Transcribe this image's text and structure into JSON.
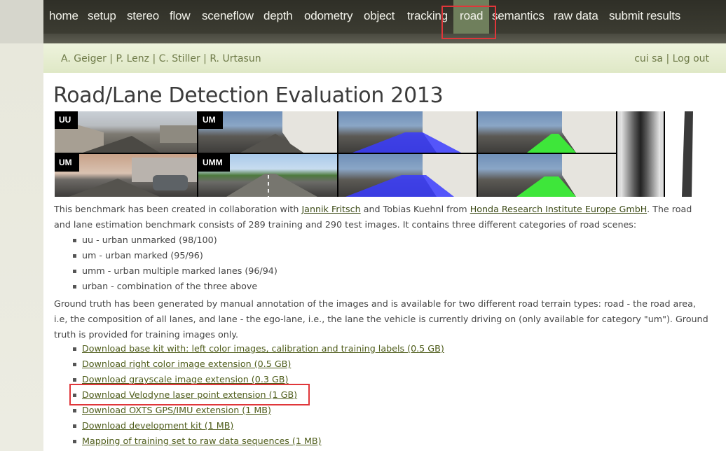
{
  "nav": {
    "items": [
      "home",
      "setup",
      "stereo",
      "flow",
      "sceneflow",
      "depth",
      "odometry",
      "object",
      "tracking",
      "road",
      "semantics",
      "raw data",
      "submit results"
    ],
    "active": "road"
  },
  "subheader": {
    "authors": "A. Geiger | P. Lenz | C. Stiller | R. Urtasun",
    "user": "cui sa",
    "separator": "|",
    "logout": "Log out"
  },
  "title": "Road/Lane Detection Evaluation 2013",
  "images": {
    "labels": [
      "UU",
      "UM",
      "UM",
      "UMM"
    ]
  },
  "intro": {
    "p1_a": "This benchmark has been created in collaboration with ",
    "link_fritsch": "Jannik Fritsch",
    "p1_b": " and Tobias Kuehnl from ",
    "link_honda": "Honda Research Institute Europe GmbH",
    "p1_c": ". The road and lane estimation benchmark consists of 289 training and 290 test images. It contains three different categories of road scenes:"
  },
  "categories": [
    "uu - urban unmarked (98/100)",
    "um - urban marked (95/96)",
    "umm - urban multiple marked lanes (96/94)",
    "urban - combination of the three above"
  ],
  "ground_truth": "Ground truth has been generated by manual annotation of the images and is available for two different road terrain types: road - the road area, i.e, the composition of all lanes, and lane - the ego-lane, i.e., the lane the vehicle is currently driving on (only available for category \"um\"). Ground truth is provided for training images only.",
  "downloads": [
    "Download base kit with: left color images, calibration and training labels (0.5 GB)",
    "Download right color image extension (0.5 GB)",
    "Download grayscale image extension (0.3 GB)",
    "Download Velodyne laser point extension (1 GB)",
    "Download OXTS GPS/IMU extension (1 MB)",
    "Download development kit (1 MB)",
    "Mapping of training set to raw data sequences (1 MB)"
  ],
  "colors": {
    "nav_bg": "#35352c",
    "nav_active": "#6f7f5c",
    "subheader_bg": "#e6edd0",
    "link": "#4e5c1a",
    "highlight": "#e0363a",
    "road_blue": "#3a3cff",
    "lane_green": "#3ee63a"
  }
}
